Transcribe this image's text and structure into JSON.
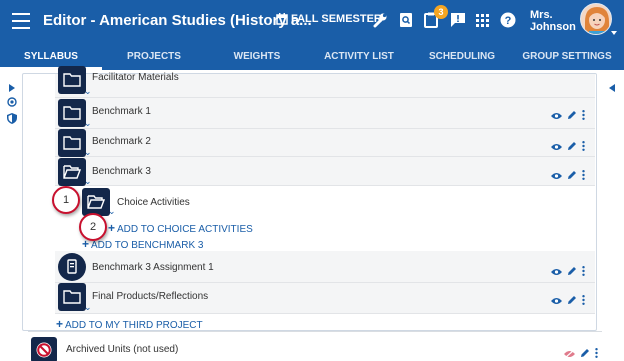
{
  "header": {
    "title": "Editor - American Studies (History a...",
    "semester": "FALL SEMESTER",
    "notification_count": "3",
    "user_name_line1": "Mrs.",
    "user_name_line2": "Johnson",
    "bar_color": "#1a5ea8"
  },
  "tabs": [
    {
      "label": "SYLLABUS",
      "active": true
    },
    {
      "label": "PROJECTS"
    },
    {
      "label": "WEIGHTS"
    },
    {
      "label": "ACTIVITY LIST"
    },
    {
      "label": "SCHEDULING"
    },
    {
      "label": "GROUP SETTINGS"
    }
  ],
  "rows": {
    "facilitator": "Facilitator Materials",
    "benchmark1": "Benchmark 1",
    "benchmark2": "Benchmark 2",
    "benchmark3": "Benchmark 3",
    "choice": "Choice Activities",
    "assignment": "Benchmark 3 Assignment 1",
    "final": "Final Products/Reflections",
    "archived": "Archived Units (not used)"
  },
  "links": {
    "add_choice": "ADD TO CHOICE ACTIVITIES",
    "add_benchmark": "ADD TO BENCHMARK 3",
    "add_project": "ADD TO MY THIRD PROJECT"
  },
  "callouts": [
    "1",
    "2"
  ],
  "icons": [
    "menu-icon",
    "calendar-icon",
    "wrench-icon",
    "search-doc-icon",
    "clipboard-icon",
    "message-alert-icon",
    "apps-grid-icon",
    "help-icon",
    "folder-icon",
    "folder-open-icon",
    "document-icon",
    "eye-icon",
    "pencil-icon",
    "more-vert-icon"
  ]
}
